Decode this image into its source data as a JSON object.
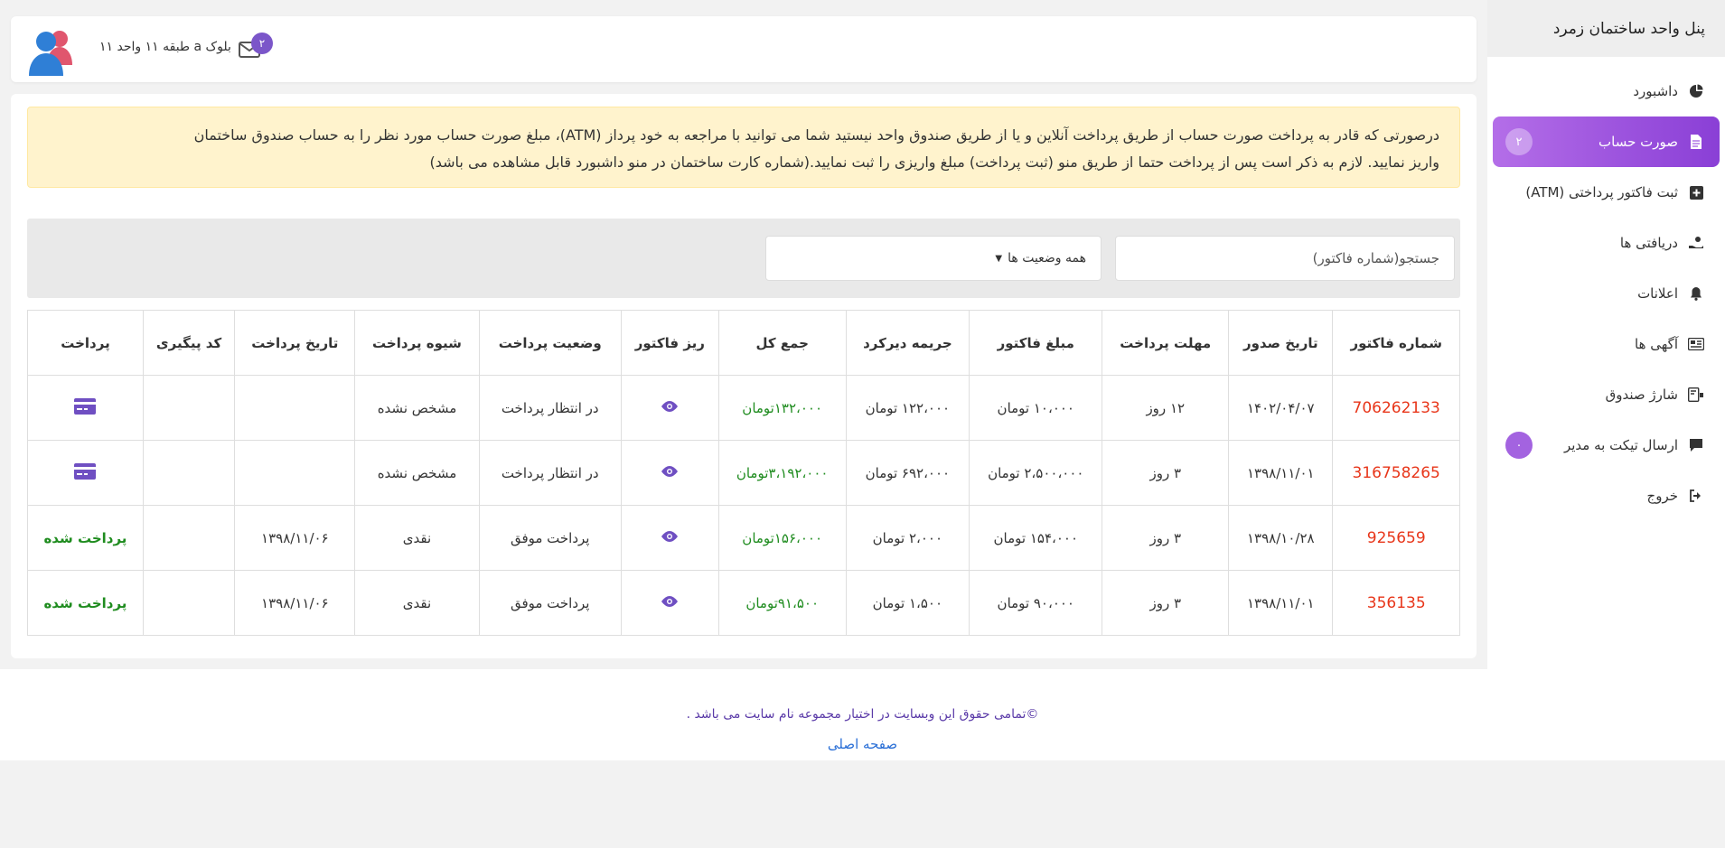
{
  "sidebar": {
    "title": "پنل واحد ساختمان زمرد",
    "items": [
      {
        "label": "داشبورد",
        "icon": "pie-chart-icon"
      },
      {
        "label": "صورت حساب",
        "icon": "document-icon",
        "badge": "۲",
        "active": true
      },
      {
        "label": "ثبت فاکتور پرداختی (ATM)",
        "icon": "plus-square-icon"
      },
      {
        "label": "دریافتی ها",
        "icon": "hand-coin-icon"
      },
      {
        "label": "اعلانات",
        "icon": "bell-icon"
      },
      {
        "label": "آگهی ها",
        "icon": "newspaper-icon"
      },
      {
        "label": "شارژ صندوق",
        "icon": "wallet-icon"
      },
      {
        "label": "ارسال تیکت به مدیر",
        "icon": "comment-icon",
        "badge": "۰"
      },
      {
        "label": "خروج",
        "icon": "sign-out-icon"
      }
    ]
  },
  "topbar": {
    "unit_text": "بلوک a طبقه ۱۱ واحد ۱۱",
    "mail_badge": "۲"
  },
  "alert": {
    "line1": "درصورتی که قادر به پرداخت صورت حساب از طریق پرداخت آنلاین و یا از طریق صندوق واحد نیستید شما می توانید با مراجعه به خود پرداز (ATM)، مبلغ صورت حساب مورد نظر را به حساب صندوق ساختمان",
    "line2": "واریز نمایید. لازم به ذکر است پس از پرداخت حتما از طریق منو (ثبت پرداخت) مبلغ واریزی را ثبت نمایید.(شماره کارت ساختمان در منو داشبورد قابل مشاهده می باشد)"
  },
  "filters": {
    "search_placeholder": "جستجو(شماره فاکتور)",
    "status_selected": "همه وضعیت ها"
  },
  "table": {
    "headers": [
      "شماره فاکتور",
      "تاریخ صدور",
      "مهلت پرداخت",
      "مبلغ فاکتور",
      "جریمه دیرکرد",
      "جمع کل",
      "ریز فاکتور",
      "وضعیت پرداخت",
      "شیوه پرداخت",
      "تاریخ پرداخت",
      "کد پیگیری",
      "پرداخت"
    ],
    "rows": [
      {
        "invoice": "706262133",
        "issue_date": "۱۴۰۲/۰۴/۰۷",
        "deadline": "۱۲ روز",
        "amount": "۱۰،۰۰۰ تومان",
        "penalty": "۱۲۲،۰۰۰ تومان",
        "total": "۱۳۲،۰۰۰تومان",
        "status": "در انتظار پرداخت",
        "method": "مشخص نشده",
        "pay_date": "",
        "tracking": "",
        "pay": "card"
      },
      {
        "invoice": "316758265",
        "issue_date": "۱۳۹۸/۱۱/۰۱",
        "deadline": "۳ روز",
        "amount": "۲،۵۰۰،۰۰۰ تومان",
        "penalty": "۶۹۲،۰۰۰ تومان",
        "total": "۳،۱۹۲،۰۰۰تومان",
        "status": "در انتظار پرداخت",
        "method": "مشخص نشده",
        "pay_date": "",
        "tracking": "",
        "pay": "card"
      },
      {
        "invoice": "925659",
        "issue_date": "۱۳۹۸/۱۰/۲۸",
        "deadline": "۳ روز",
        "amount": "۱۵۴،۰۰۰ تومان",
        "penalty": "۲،۰۰۰ تومان",
        "total": "۱۵۶،۰۰۰تومان",
        "status": "پرداخت موفق",
        "method": "نقدی",
        "pay_date": "۱۳۹۸/۱۱/۰۶",
        "tracking": "",
        "pay": "پرداخت شده"
      },
      {
        "invoice": "356135",
        "issue_date": "۱۳۹۸/۱۱/۰۱",
        "deadline": "۳ روز",
        "amount": "۹۰،۰۰۰ تومان",
        "penalty": "۱،۵۰۰ تومان",
        "total": "۹۱،۵۰۰تومان",
        "status": "پرداخت موفق",
        "method": "نقدی",
        "pay_date": "۱۳۹۸/۱۱/۰۶",
        "tracking": "",
        "pay": "پرداخت شده"
      }
    ]
  },
  "footer": {
    "copyright": "©تمامی حقوق این وبسایت در اختیار مجموعه نام سایت می باشد .",
    "home_link": "صفحه اصلی"
  },
  "colors": {
    "accent": "#8a3fd6",
    "alert_bg": "#fff3cd",
    "invoice_red": "#e8361a",
    "success_green": "#1f8c1f",
    "icon_purple": "#6f4fc2"
  }
}
